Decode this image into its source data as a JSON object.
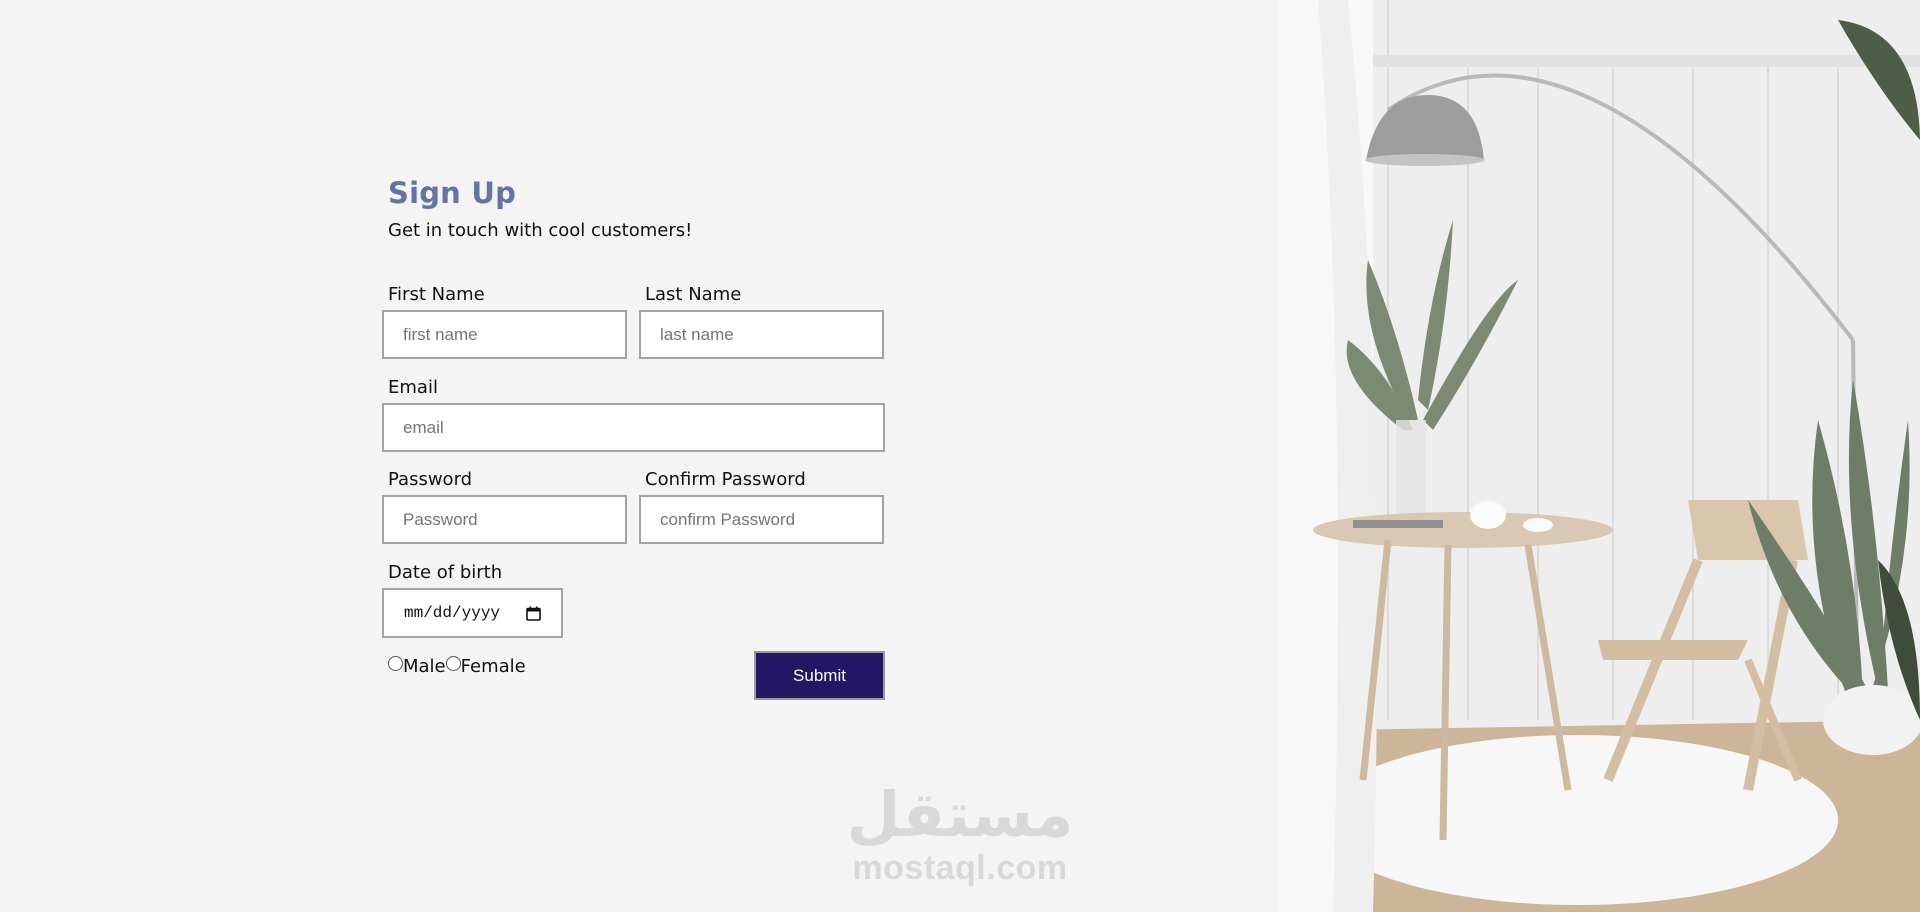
{
  "form": {
    "title": "Sign Up",
    "subtitle": "Get in touch with cool customers!",
    "first_name": {
      "label": "First Name",
      "placeholder": "first name"
    },
    "last_name": {
      "label": "Last Name",
      "placeholder": "last name"
    },
    "email": {
      "label": "Email",
      "placeholder": "email"
    },
    "password": {
      "label": "Password",
      "placeholder": "Password"
    },
    "confirm_password": {
      "label": "Confirm Password",
      "placeholder": "confirm Password"
    },
    "dob": {
      "label": "Date of birth",
      "placeholder": "mm/dd/yyyy"
    },
    "gender": {
      "male": "Male",
      "female": "Female"
    },
    "submit_label": "Submit"
  },
  "watermark": {
    "arabic": "مستقل",
    "latin": "mostaql.com"
  },
  "colors": {
    "title": "#6373a6",
    "submit_bg": "#231765",
    "background": "#f4f4f4"
  },
  "icons": {
    "date_picker": "calendar-icon"
  }
}
